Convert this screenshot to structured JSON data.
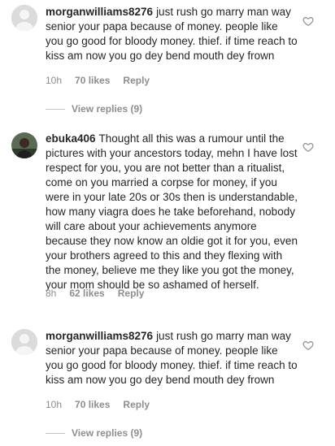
{
  "comments": [
    {
      "username": "morganwilliams8276",
      "text": "just rush go marry man way senior your papa because of money. people like you go good for bloody money. thief. if time reach to kiss am now you go dey bend mouth dey frown",
      "time": "10h",
      "likes": "70 likes",
      "reply": "Reply",
      "view_replies": "View replies (9)"
    },
    {
      "username": "ebuka406",
      "text": "Thought all this was a rumour until the pictures with your ancestors today, mehn I have lost respect for you, you are not better than a ritualist, come on you married a corpse for money, if you were in your late 20s or 30s then is understandable, how many viagra does he take beforehand, nobody will care about your achievements anymore because they now know an oldie got it for you, even your brothers agreed to this and they flexing with the money, believe me they like you got the money, your mom should be so ashamed of herself.",
      "time": "8h",
      "likes": "62 likes",
      "reply": "Reply"
    },
    {
      "username": "morganwilliams8276",
      "text": "just rush go marry man way senior your papa because of money. people like you go good for bloody money. thief. if time reach to kiss am now you go dey bend mouth dey frown",
      "time": "10h",
      "likes": "70 likes",
      "reply": "Reply",
      "view_replies": "View replies (9)"
    }
  ],
  "icons": {
    "like": "heart-outline-icon",
    "avatar_default": "person-silhouette-icon"
  }
}
